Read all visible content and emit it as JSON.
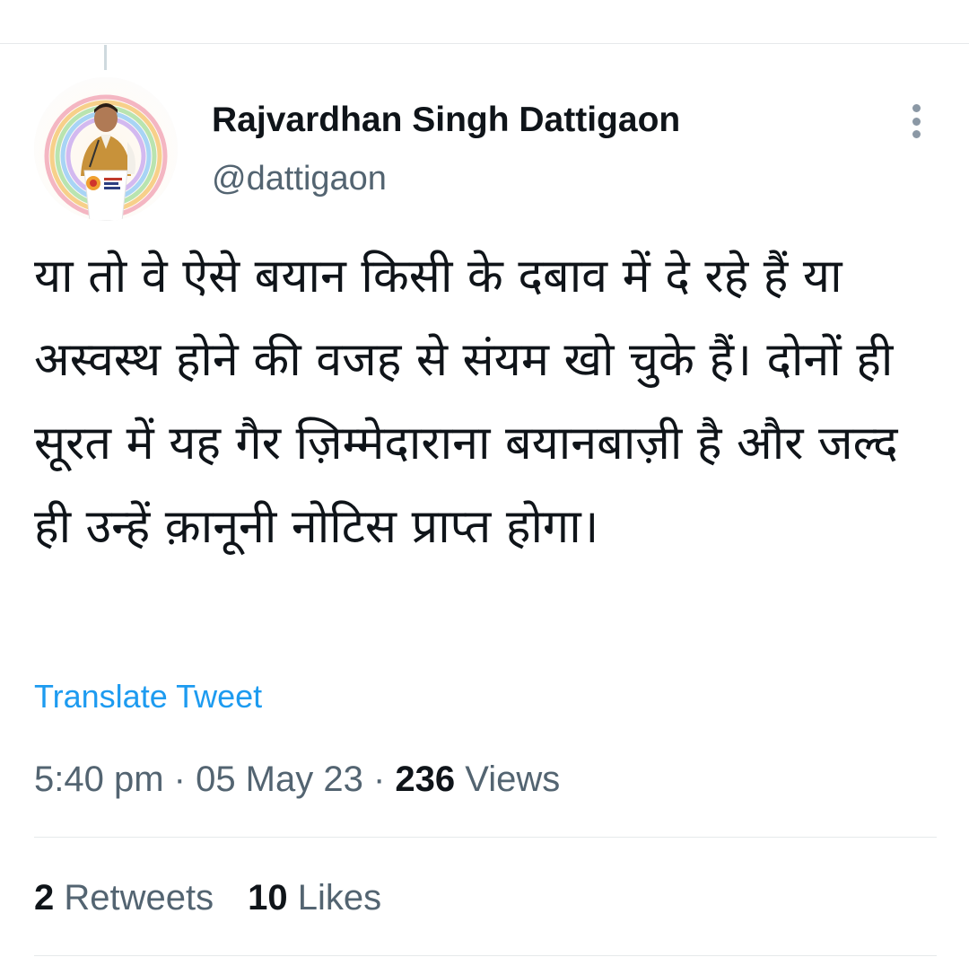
{
  "author": {
    "name": "Rajvardhan Singh Dattigaon",
    "handle": "@dattigaon",
    "avatar_icon": "profile-photo-icon"
  },
  "tweet": {
    "text": "या तो वे ऐसे बयान किसी के दबाव में दे रहे हैं या अस्वस्थ होने की वजह से संयम खो चुके हैं। दोनों ही सूरत में यह गैर ज़िम्मेदाराना बयानबाज़ी है और जल्द ही उन्हें क़ानूनी नोटिस प्राप्त होगा।",
    "translate_label": "Translate Tweet"
  },
  "meta": {
    "time": "5:40 pm",
    "separator": " · ",
    "date": "05 May 23",
    "views_count": "236",
    "views_label": "Views"
  },
  "stats": {
    "retweets_count": "2",
    "retweets_label": "Retweets",
    "likes_count": "10",
    "likes_label": "Likes"
  },
  "colors": {
    "link": "#1d9bf0",
    "secondary_text": "#536471",
    "primary_text": "#0f1419",
    "divider": "#e6e9eb"
  }
}
